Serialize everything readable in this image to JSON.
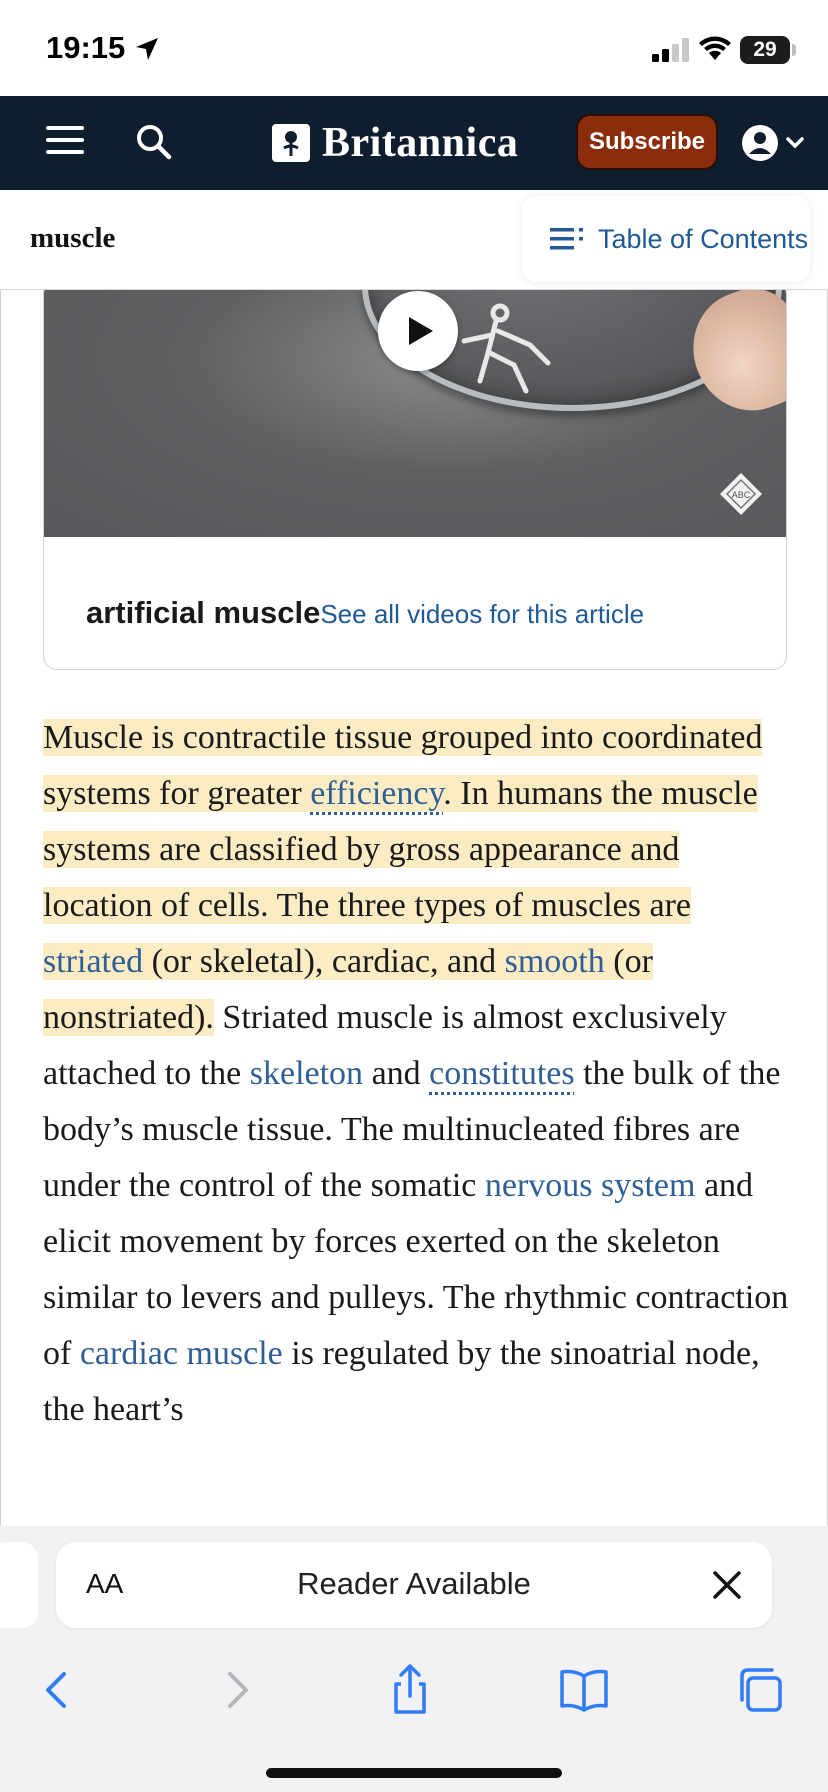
{
  "status_bar": {
    "time": "19:15",
    "battery": "29"
  },
  "header": {
    "brand": "Britannica",
    "subscribe_label": "Subscribe"
  },
  "article": {
    "title": "muscle",
    "toc_label": "Table of Contents"
  },
  "video": {
    "title": "artificial muscle",
    "link_label": "See all videos for this article"
  },
  "paragraph": {
    "hl_1": "Muscle is contractile tissue grouped into coordinated systems for greater ",
    "link_efficiency": "efficiency",
    "hl_2": ". In humans the muscle systems are classified by gross appearance and location of cells. The three types of muscles are ",
    "link_striated": "striated",
    "hl_3": " (or skeletal), cardiac, and ",
    "link_smooth": "smooth",
    "hl_4": " (or nonstriated).",
    "t_1": " Striated muscle is almost exclusively attached to the ",
    "link_skeleton": "skeleton",
    "t_2": " and ",
    "link_constitutes": "constitutes",
    "t_3": " the bulk of the body’s muscle tissue. The multinucleated fibres are under the control of the somatic ",
    "link_nervous": "nervous system",
    "t_4": " and elicit movement by forces exerted on the skeleton similar to levers and pulleys. The rhythmic contraction of ",
    "link_cardiac": "cardiac muscle",
    "t_5": " is regulated by the sinoatrial node, the heart’s"
  },
  "reader": {
    "aa_label": "AA",
    "text": "Reader Available"
  },
  "icons": {
    "back": "chevron-left-icon",
    "forward": "chevron-right-icon",
    "share": "share-icon",
    "bookmarks": "book-icon",
    "tabs": "tabs-icon"
  },
  "colors": {
    "header_bg": "#0f1e2e",
    "subscribe_bg": "#8b2d0c",
    "link": "#2f5f96",
    "highlight": "#fbecc4",
    "toolbar_icon": "#2f7cf6"
  }
}
